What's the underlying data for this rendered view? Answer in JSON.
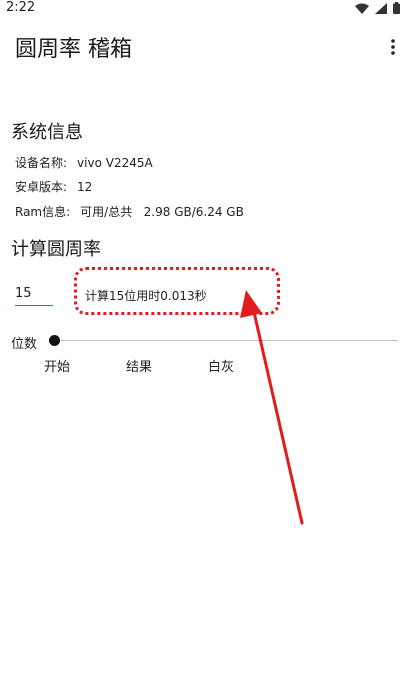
{
  "status_bar": {
    "time": "2:22"
  },
  "app": {
    "title": "圆周率 稽箱"
  },
  "system_info": {
    "heading": "系统信息",
    "device_label": "设备名称:",
    "device_value": "vivo V2245A",
    "android_label": "安卓版本:",
    "android_value": "12",
    "ram_label": "Ram信息:",
    "ram_value": "可用/总共   2.98 GB/6.24 GB"
  },
  "calculate": {
    "heading": "计算圆周率",
    "digits_value": "15",
    "result_text": "计算15位用时0.013秒"
  },
  "slider": {
    "label": "位数",
    "level": 0
  },
  "buttons": {
    "start": "开始",
    "result": "结果",
    "white_gray": "白灰"
  },
  "colors": {
    "accent": "#1f7fb5",
    "annotation_red": "#e21c1c"
  },
  "icons": [
    "wifi-icon",
    "signal-icon",
    "battery-icon",
    "more-vert-icon",
    "arrow-annotation-icon"
  ]
}
